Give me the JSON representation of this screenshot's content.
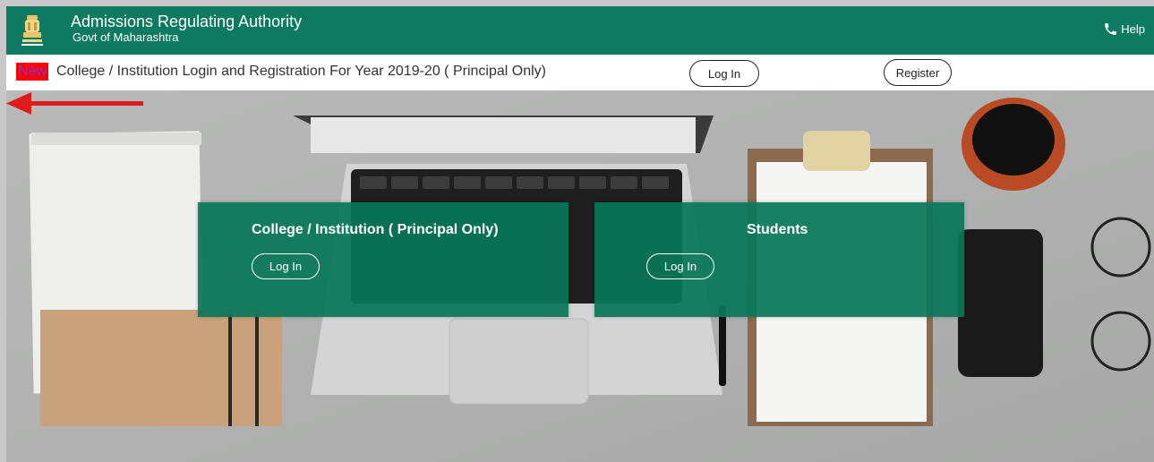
{
  "header": {
    "title": "Admissions Regulating Authority",
    "subtitle": "Govt of Maharashtra",
    "help_label": "Help",
    "emblem_icon": "state-emblem-icon",
    "help_icon": "phone-icon"
  },
  "announcement": {
    "badge": "New",
    "text": "College / Institution Login and Registration For Year 2019-20 ( Principal Only)",
    "login_label": "Log In",
    "register_label": "Register"
  },
  "panels": {
    "college": {
      "title": "College / Institution ( Principal Only)",
      "login_label": "Log In"
    },
    "students": {
      "title": "Students",
      "login_label": "Log In"
    }
  },
  "colors": {
    "header_bg": "#0e7a61",
    "panel_bg": "#087658",
    "badge_bg": "#ff0000",
    "arrow": "#e01b1b"
  }
}
